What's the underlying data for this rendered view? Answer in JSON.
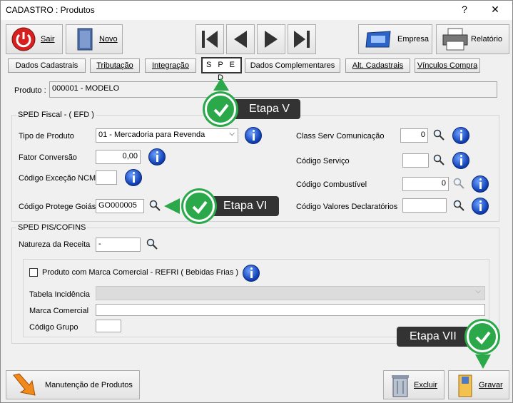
{
  "window": {
    "title": "CADASTRO : Produtos",
    "help": "?",
    "close": "✕"
  },
  "toolbar": {
    "sair": "Sair",
    "novo": "Novo",
    "empresa": "Empresa",
    "relatorio": "Relatório"
  },
  "tabs": [
    "Dados Cadastrais",
    "Tributação",
    "Integração",
    "S P E D",
    "Dados Complementares",
    "Alt. Cadastrais",
    "Vínculos Compra"
  ],
  "produto": {
    "label": "Produto :",
    "value": "000001 - MODELO"
  },
  "sped_fiscal": {
    "group_label": "SPED Fiscal  - ( EFD )",
    "tipo_produto_label": "Tipo de Produto",
    "tipo_produto_value": "01 - Mercadoria para Revenda",
    "fator_label": "Fator Conversão",
    "fator_value": "0,00",
    "ncm_label": "Código Exceção NCM",
    "ncm_value": "",
    "protege_label": "Código Protege Goiás",
    "protege_value": "GO000005",
    "class_serv_label": "Class Serv Comunicação",
    "class_serv_value": "0",
    "cod_servico_label": "Código Serviço",
    "cod_servico_value": "",
    "cod_comb_label": "Código Combustível",
    "cod_comb_value": "0",
    "cod_valores_label": "Código Valores Declaratórios",
    "cod_valores_value": ""
  },
  "sped_pis": {
    "group_label": "SPED PIS/COFINS",
    "natureza_label": "Natureza da Receita",
    "natureza_value": "-",
    "marca_check_label": "Produto com Marca Comercial - REFRI ( Bebidas Frias )",
    "tabela_label": "Tabela Incidência",
    "marca_label": "Marca Comercial",
    "grupo_label": "Código Grupo"
  },
  "bottom": {
    "manutencao": "Manutenção de Produtos",
    "excluir": "Excluir",
    "gravar": "Gravar"
  },
  "callouts": {
    "etapa5": "Etapa V",
    "etapa6": "Etapa VI",
    "etapa7": "Etapa VII"
  },
  "colors": {
    "callout_bg": "#333333",
    "check_green": "#2aa84a"
  }
}
